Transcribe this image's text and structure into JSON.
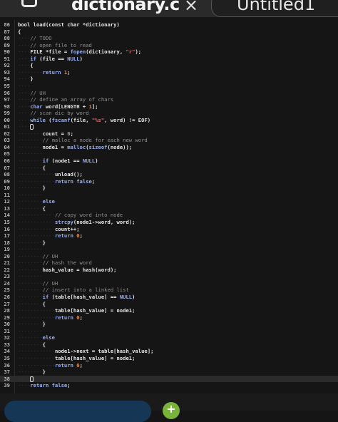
{
  "tabs": [
    {
      "title": "dictionary.c",
      "close_glyph": "×",
      "icon": "tab-square-icon"
    },
    {
      "title": "Untitled1"
    }
  ],
  "editor": {
    "lines": [
      {
        "n": "86",
        "segs": [
          [
            "bool load(const char *dictionary)",
            "t"
          ]
        ]
      },
      {
        "n": "87",
        "segs": [
          [
            "{",
            "t"
          ]
        ]
      },
      {
        "n": "88",
        "segs": [
          [
            "    ",
            "d"
          ],
          [
            "// TODO",
            "c"
          ]
        ]
      },
      {
        "n": "89",
        "segs": [
          [
            "    ",
            "d"
          ],
          [
            "// open file to read",
            "c"
          ]
        ]
      },
      {
        "n": "90",
        "segs": [
          [
            "    ",
            "d"
          ],
          [
            "FILE *file = ",
            "t"
          ],
          [
            "fopen",
            "k"
          ],
          [
            "(dictionary, ",
            "t"
          ],
          [
            "\"r\"",
            "s"
          ],
          [
            ");",
            "t"
          ]
        ]
      },
      {
        "n": "91",
        "segs": [
          [
            "    ",
            "d"
          ],
          [
            "if",
            "k"
          ],
          [
            " (file == ",
            "t"
          ],
          [
            "NULL",
            "k"
          ],
          [
            ")",
            "t"
          ]
        ]
      },
      {
        "n": "92",
        "segs": [
          [
            "    ",
            "d"
          ],
          [
            "{",
            "t"
          ]
        ]
      },
      {
        "n": "93",
        "segs": [
          [
            "        ",
            "d"
          ],
          [
            "return",
            "k"
          ],
          [
            " ",
            "t"
          ],
          [
            "1",
            "n"
          ],
          [
            ";",
            "t"
          ]
        ]
      },
      {
        "n": "94",
        "segs": [
          [
            "    ",
            "d"
          ],
          [
            "}",
            "t"
          ]
        ]
      },
      {
        "n": "95",
        "segs": [
          [
            "    ",
            "d"
          ]
        ]
      },
      {
        "n": "96",
        "segs": [
          [
            "    ",
            "d"
          ],
          [
            "// UH",
            "c"
          ]
        ]
      },
      {
        "n": "97",
        "segs": [
          [
            "    ",
            "d"
          ],
          [
            "// define an array of chars",
            "c"
          ]
        ]
      },
      {
        "n": "98",
        "segs": [
          [
            "    ",
            "d"
          ],
          [
            "char",
            "k"
          ],
          [
            " word[LENGTH + ",
            "t"
          ],
          [
            "1",
            "n"
          ],
          [
            "];",
            "t"
          ]
        ]
      },
      {
        "n": "99",
        "segs": [
          [
            "    ",
            "d"
          ],
          [
            "// scan dic by word",
            "c"
          ]
        ]
      },
      {
        "n": "00",
        "segs": [
          [
            "    ",
            "d"
          ],
          [
            "while",
            "k"
          ],
          [
            " (",
            "t"
          ],
          [
            "fscanf",
            "k"
          ],
          [
            "(file, ",
            "t"
          ],
          [
            "\"%s\"",
            "s"
          ],
          [
            ", word) != EOF)",
            "t"
          ]
        ]
      },
      {
        "n": "01",
        "segs": [
          [
            "    ",
            "d"
          ],
          [
            "{",
            "t"
          ]
        ],
        "cursor": true
      },
      {
        "n": "02",
        "segs": [
          [
            "        ",
            "d"
          ],
          [
            "count = ",
            "t"
          ],
          [
            "0",
            "n"
          ],
          [
            ";",
            "t"
          ]
        ]
      },
      {
        "n": "03",
        "segs": [
          [
            "        ",
            "d"
          ],
          [
            "// malloc a node for each new word",
            "c"
          ]
        ]
      },
      {
        "n": "04",
        "segs": [
          [
            "        ",
            "d"
          ],
          [
            "node1 = ",
            "t"
          ],
          [
            "malloc",
            "k"
          ],
          [
            "(",
            "t"
          ],
          [
            "sizeof",
            "k"
          ],
          [
            "(node));",
            "t"
          ]
        ]
      },
      {
        "n": "05",
        "segs": [
          [
            "        ",
            "d"
          ]
        ]
      },
      {
        "n": "06",
        "segs": [
          [
            "        ",
            "d"
          ],
          [
            "if",
            "k"
          ],
          [
            " (node1 == ",
            "t"
          ],
          [
            "NULL",
            "k"
          ],
          [
            ")",
            "t"
          ]
        ]
      },
      {
        "n": "07",
        "segs": [
          [
            "        ",
            "d"
          ],
          [
            "{",
            "t"
          ]
        ]
      },
      {
        "n": "08",
        "segs": [
          [
            "            ",
            "d"
          ],
          [
            "unload();",
            "t"
          ]
        ]
      },
      {
        "n": "09",
        "segs": [
          [
            "            ",
            "d"
          ],
          [
            "return",
            "k"
          ],
          [
            " ",
            "t"
          ],
          [
            "false",
            "k"
          ],
          [
            ";",
            "t"
          ]
        ]
      },
      {
        "n": "10",
        "segs": [
          [
            "        ",
            "d"
          ],
          [
            "}",
            "t"
          ]
        ]
      },
      {
        "n": "11",
        "segs": [
          [
            "        ",
            "d"
          ]
        ]
      },
      {
        "n": "12",
        "segs": [
          [
            "        ",
            "d"
          ],
          [
            "else",
            "k"
          ]
        ]
      },
      {
        "n": "13",
        "segs": [
          [
            "        ",
            "d"
          ],
          [
            "{",
            "t"
          ]
        ]
      },
      {
        "n": "14",
        "segs": [
          [
            "            ",
            "d"
          ],
          [
            "// copy word into node",
            "c"
          ]
        ]
      },
      {
        "n": "15",
        "segs": [
          [
            "            ",
            "d"
          ],
          [
            "strcpy",
            "k"
          ],
          [
            "(node1->word, word);",
            "t"
          ]
        ]
      },
      {
        "n": "16",
        "segs": [
          [
            "            ",
            "d"
          ],
          [
            "count++;",
            "t"
          ]
        ]
      },
      {
        "n": "17",
        "segs": [
          [
            "            ",
            "d"
          ],
          [
            "return",
            "k"
          ],
          [
            " ",
            "t"
          ],
          [
            "0",
            "n"
          ],
          [
            ";",
            "t"
          ]
        ]
      },
      {
        "n": "18",
        "segs": [
          [
            "        ",
            "d"
          ],
          [
            "}",
            "t"
          ]
        ]
      },
      {
        "n": "19",
        "segs": [
          [
            "        ",
            "d"
          ]
        ]
      },
      {
        "n": "20",
        "segs": [
          [
            "        ",
            "d"
          ],
          [
            "// UH",
            "c"
          ]
        ]
      },
      {
        "n": "21",
        "segs": [
          [
            "        ",
            "d"
          ],
          [
            "// hash the word",
            "c"
          ]
        ]
      },
      {
        "n": "22",
        "segs": [
          [
            "        ",
            "d"
          ],
          [
            "hash_value = hash(word);",
            "t"
          ]
        ]
      },
      {
        "n": "23",
        "segs": [
          [
            "        ",
            "d"
          ]
        ]
      },
      {
        "n": "24",
        "segs": [
          [
            "        ",
            "d"
          ],
          [
            "// UH",
            "c"
          ]
        ]
      },
      {
        "n": "25",
        "segs": [
          [
            "        ",
            "d"
          ],
          [
            "// insert into a linked list",
            "c"
          ]
        ]
      },
      {
        "n": "26",
        "segs": [
          [
            "        ",
            "d"
          ],
          [
            "if",
            "k"
          ],
          [
            " (table[hash_value] == ",
            "t"
          ],
          [
            "NULL",
            "k"
          ],
          [
            ")",
            "t"
          ]
        ]
      },
      {
        "n": "27",
        "segs": [
          [
            "        ",
            "d"
          ],
          [
            "{",
            "t"
          ]
        ]
      },
      {
        "n": "28",
        "segs": [
          [
            "            ",
            "d"
          ],
          [
            "table[hash_value] = node1;",
            "t"
          ]
        ]
      },
      {
        "n": "29",
        "segs": [
          [
            "            ",
            "d"
          ],
          [
            "return",
            "k"
          ],
          [
            " ",
            "t"
          ],
          [
            "0",
            "n"
          ],
          [
            ";",
            "t"
          ]
        ]
      },
      {
        "n": "30",
        "segs": [
          [
            "        ",
            "d"
          ],
          [
            "}",
            "t"
          ]
        ]
      },
      {
        "n": "31",
        "segs": [
          [
            "        ",
            "d"
          ]
        ]
      },
      {
        "n": "32",
        "segs": [
          [
            "        ",
            "d"
          ],
          [
            "else",
            "k"
          ]
        ]
      },
      {
        "n": "33",
        "segs": [
          [
            "        ",
            "d"
          ],
          [
            "{",
            "t"
          ]
        ]
      },
      {
        "n": "34",
        "segs": [
          [
            "            ",
            "d"
          ],
          [
            "node1->next = table[hash_value];",
            "t"
          ]
        ]
      },
      {
        "n": "35",
        "segs": [
          [
            "            ",
            "d"
          ],
          [
            "table[hash_value] = node1;",
            "t"
          ]
        ]
      },
      {
        "n": "36",
        "segs": [
          [
            "            ",
            "d"
          ],
          [
            "return",
            "k"
          ],
          [
            " ",
            "t"
          ],
          [
            "0",
            "n"
          ],
          [
            ";",
            "t"
          ]
        ]
      },
      {
        "n": "37",
        "segs": [
          [
            "        ",
            "d"
          ],
          [
            "}",
            "t"
          ]
        ]
      },
      {
        "n": "38",
        "segs": [
          [
            "    ",
            "d"
          ],
          [
            "}",
            "t"
          ]
        ],
        "cursor_on_brace": true,
        "current": true
      },
      {
        "n": "39",
        "segs": [
          [
            "    ",
            "d"
          ],
          [
            "return",
            "k"
          ],
          [
            " ",
            "t"
          ],
          [
            "false",
            "k"
          ],
          [
            ";",
            "t"
          ]
        ]
      }
    ]
  },
  "bottom": {
    "plus_label": "+"
  }
}
